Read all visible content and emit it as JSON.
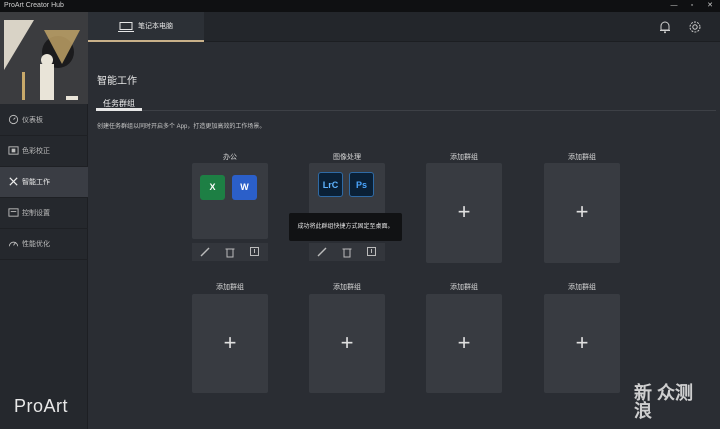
{
  "window": {
    "title": "ProArt Creator Hub"
  },
  "sidebar": {
    "items": [
      {
        "label": "仪表板",
        "icon": "dashboard-icon"
      },
      {
        "label": "色彩校正",
        "icon": "color-calibration-icon"
      },
      {
        "label": "智能工作",
        "icon": "smart-work-icon"
      },
      {
        "label": "控制设置",
        "icon": "control-settings-icon"
      },
      {
        "label": "性能优化",
        "icon": "performance-icon"
      }
    ],
    "active_index": 2,
    "logo": "ProArt"
  },
  "topbar": {
    "tab_label": "笔记本电脑",
    "icons": [
      "bell-icon",
      "gear-icon"
    ]
  },
  "main": {
    "title": "智能工作",
    "subtab": "任务群组",
    "description": "创建任务群组以同时开启多个 App，打造更加高效的工作场景。",
    "groups_row1": [
      {
        "title": "办公",
        "apps": [
          {
            "text": "X",
            "color": "#1d7f44"
          },
          {
            "text": "W",
            "color": "#2b5fc9"
          }
        ],
        "filled": true
      },
      {
        "title": "图像处理",
        "apps": [
          {
            "text": "LrC",
            "color": "#0a2036"
          },
          {
            "text": "Ps",
            "color": "#0a2036"
          }
        ],
        "filled": true
      },
      {
        "title": "添加群组",
        "filled": false
      },
      {
        "title": "添加群组",
        "filled": false
      }
    ],
    "groups_row2": [
      {
        "title": "添加群组"
      },
      {
        "title": "添加群组"
      },
      {
        "title": "添加群组"
      },
      {
        "title": "添加群组"
      }
    ],
    "plus": "+"
  },
  "toast": "成功将此群组快捷方式固定至桌面。",
  "watermark": {
    "line1": "新 众测",
    "line2": "浪"
  }
}
